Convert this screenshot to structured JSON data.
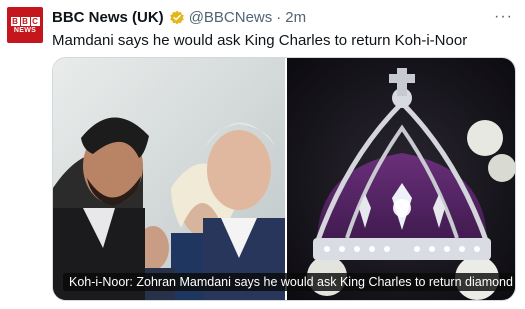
{
  "tweet": {
    "avatar": {
      "letters": [
        "B",
        "B",
        "C"
      ],
      "sub": "NEWS"
    },
    "display_name": "BBC News (UK)",
    "verified_icon": "gold-verified-badge",
    "handle": "@BBCNews",
    "separator": "·",
    "timestamp": "2m",
    "more_icon": "more-horizontal-icon",
    "more_glyph": "···",
    "text": "Mamdani says he would ask King Charles to return Koh-i-Noor",
    "media": {
      "left_image": "photo-mamdani-meeting-king-charles",
      "right_image": "photo-imperial-state-crown",
      "caption": "Koh-i-Noor: Zohran Mamdani says he would ask King Charles to return diamond"
    }
  },
  "colors": {
    "bbc_red": "#c4161c",
    "verified_gold": "#e2b719",
    "secondary_text": "#536471",
    "primary_text": "#0f1419"
  }
}
